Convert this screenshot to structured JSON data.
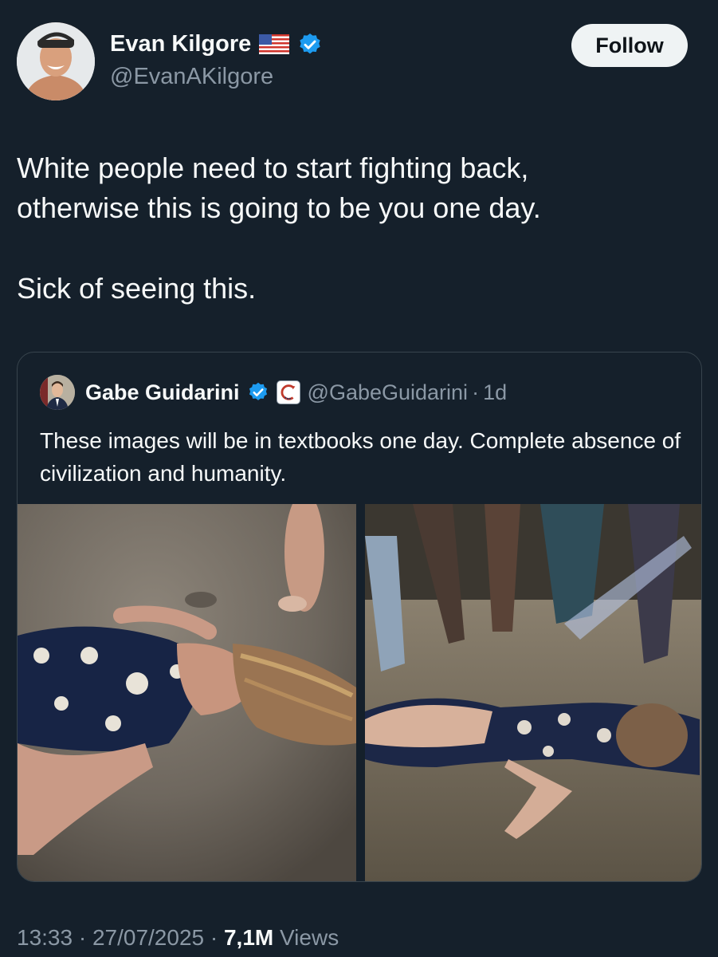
{
  "tweet": {
    "author": {
      "name": "Evan Kilgore",
      "handle": "@EvanAKilgore",
      "flag_icon": "us-flag-icon",
      "verified_icon": "verified-badge-icon"
    },
    "follow_label": "Follow",
    "text_line1": "White people need to start fighting back,",
    "text_line2": "otherwise this is going to be you one day.",
    "text_line3": "Sick of seeing this.",
    "timestamp": "13:33 · 27/07/2025 · ",
    "views_count": "7,1M",
    "views_label": " Views"
  },
  "quote": {
    "name": "Gabe Guidarini",
    "handle": "@GabeGuidarini",
    "separator": "·",
    "time": "1d",
    "text": "These images will be in textbooks one day. Complete absence of civilization and humanity.",
    "media": [
      "photo-woman-lying-on-pavement",
      "photo-woman-lying-on-pavement-surrounded-by-crowd"
    ]
  },
  "colors": {
    "background": "#15202b",
    "text_primary": "#f7f9f9",
    "text_secondary": "#8b98a5",
    "verified_blue": "#1d9bf0",
    "border": "#38444d"
  }
}
